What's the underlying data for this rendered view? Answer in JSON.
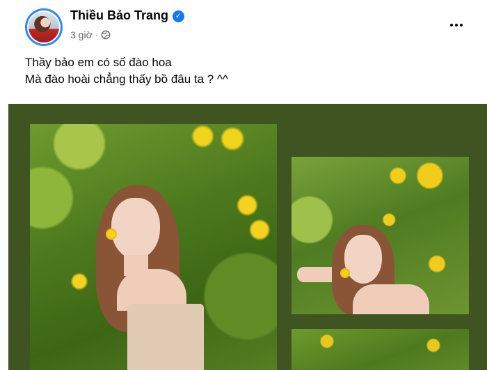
{
  "post": {
    "author": "Thiều Bảo Trang",
    "verified_icon": "check",
    "time": "3 giờ",
    "separator": "·",
    "audience_icon": "globe-icon",
    "more_icon": "more-horizontal-icon",
    "text_lines": [
      "Thầy bảo em có số đào hoa",
      "Mà đào hoài chẳng thấy bồ đâu ta ? ^^"
    ]
  },
  "colors": {
    "media_background": "#3f5420",
    "verified_badge": "#1877f2",
    "meta_text": "#65676b"
  }
}
